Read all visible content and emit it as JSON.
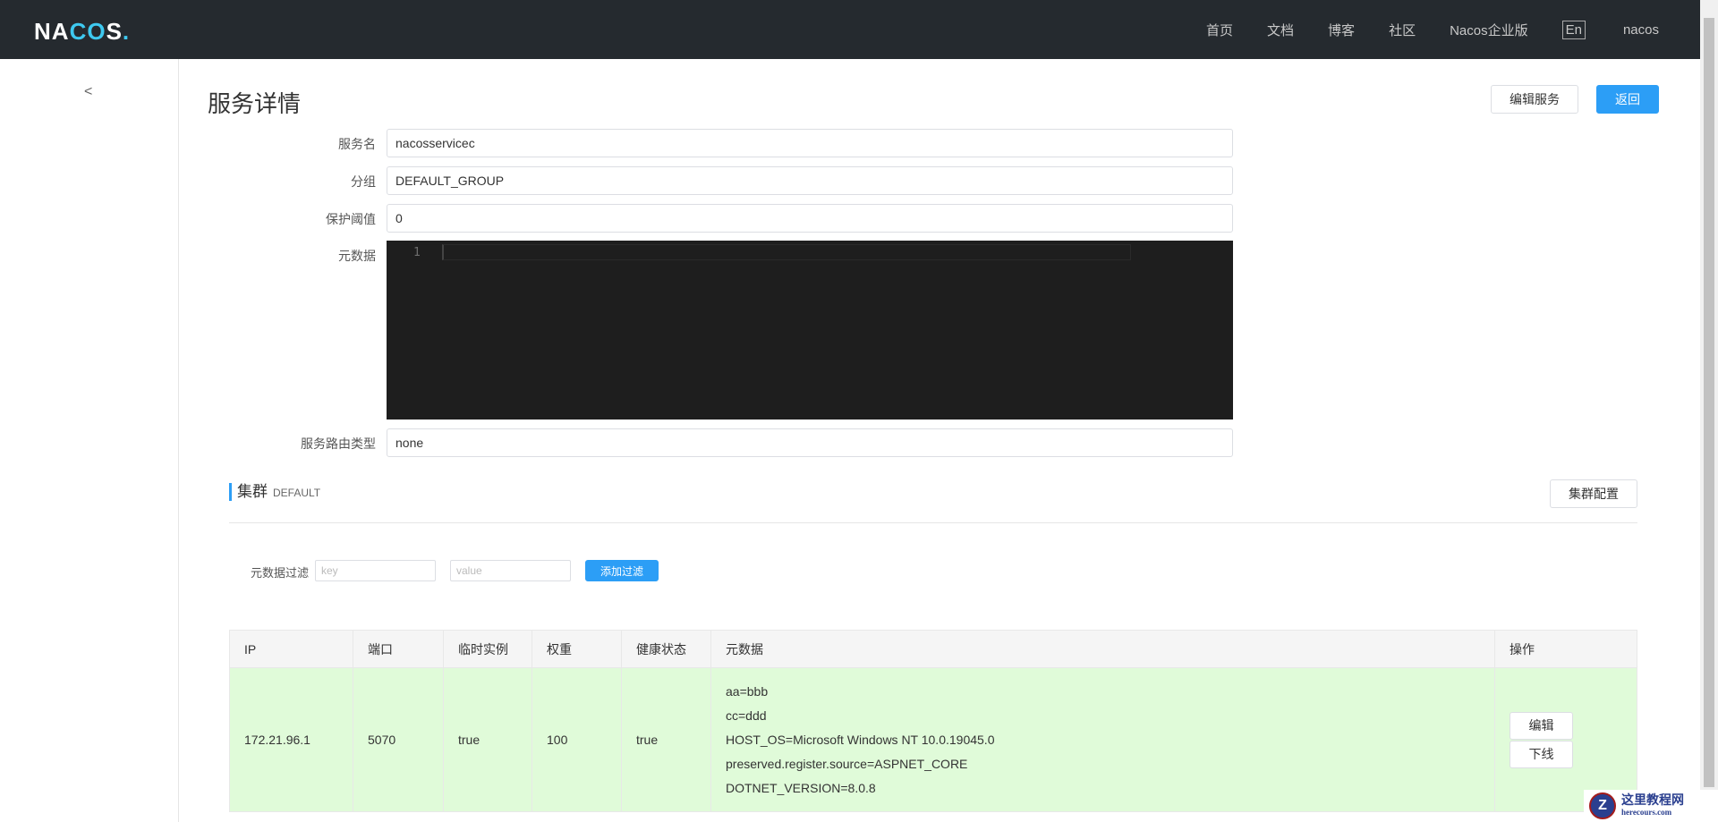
{
  "nav": {
    "logo": "NACOS.",
    "items": [
      "首页",
      "文档",
      "博客",
      "社区",
      "Nacos企业版"
    ],
    "lang": "En",
    "user": "nacos"
  },
  "page": {
    "title": "服务详情",
    "edit_service": "编辑服务",
    "back": "返回"
  },
  "form": {
    "service_name": {
      "label": "服务名",
      "value": "nacosservicec"
    },
    "group": {
      "label": "分组",
      "value": "DEFAULT_GROUP"
    },
    "threshold": {
      "label": "保护阈值",
      "value": "0"
    },
    "metadata": {
      "label": "元数据",
      "line_number": "1",
      "value": ""
    },
    "selector": {
      "label": "服务路由类型",
      "value": "none"
    }
  },
  "cluster": {
    "title": "集群",
    "name": "DEFAULT",
    "config_button": "集群配置",
    "filter": {
      "label": "元数据过滤",
      "key_placeholder": "key",
      "value_placeholder": "value",
      "add_button": "添加过滤"
    }
  },
  "table": {
    "headers": [
      "IP",
      "端口",
      "临时实例",
      "权重",
      "健康状态",
      "元数据",
      "操作"
    ],
    "rows": [
      {
        "ip": "172.21.96.1",
        "port": "5070",
        "ephemeral": "true",
        "weight": "100",
        "healthy": "true",
        "metadata": [
          "aa=bbb",
          "cc=ddd",
          "HOST_OS=Microsoft Windows NT 10.0.19045.0",
          "preserved.register.source=ASPNET_CORE",
          "DOTNET_VERSION=8.0.8"
        ],
        "actions": [
          "编辑",
          "下线"
        ]
      }
    ],
    "row_color": "#e0fbd9"
  },
  "watermark": {
    "title": "这里教程网",
    "url": "herecours.com"
  },
  "colors": {
    "primary": "#2c9ef6",
    "nav_bg": "#252a2f"
  }
}
